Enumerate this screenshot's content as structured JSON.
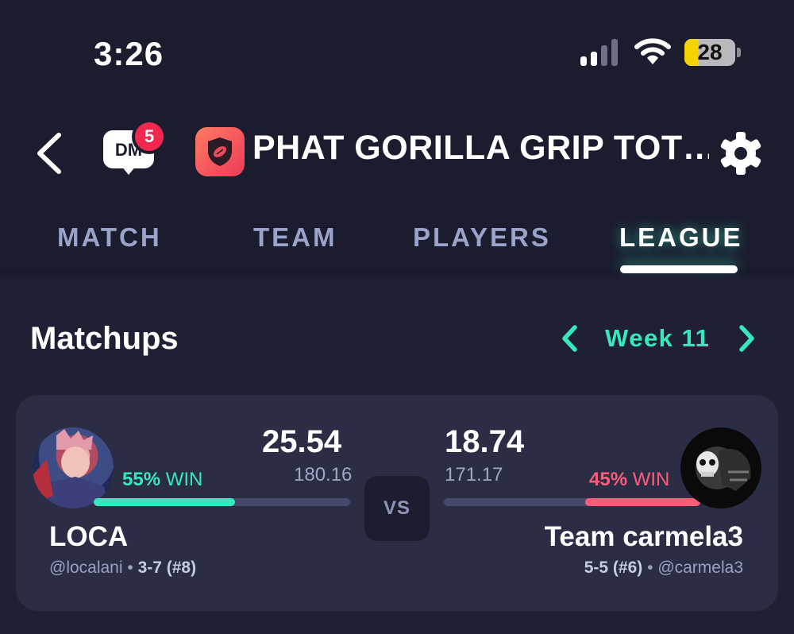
{
  "status_bar": {
    "time": "3:26",
    "battery": "28",
    "battery_level": 0.28
  },
  "nav": {
    "dm_label": "DM",
    "dm_badge": "5",
    "league_name": "PHAT GORILLA GRIP TOT…",
    "icons": [
      "back-chevron-icon",
      "dm-chat-icon",
      "football-shield-icon",
      "gear-icon"
    ]
  },
  "tabs": [
    {
      "label": "MATCH",
      "active": false
    },
    {
      "label": "TEAM",
      "active": false
    },
    {
      "label": "PLAYERS",
      "active": false
    },
    {
      "label": "LEAGUE",
      "active": true
    }
  ],
  "matchups": {
    "title": "Matchups",
    "week_label": "Week 11"
  },
  "matchup": {
    "vs_label": "VS",
    "win_label": "WIN",
    "left": {
      "score": "25.54",
      "projected": "180.16",
      "win_pct": "55%",
      "win_fraction": 0.55,
      "team_name": "LOCA",
      "handle": "@localani",
      "record": "3-7 (#8)"
    },
    "right": {
      "score": "18.74",
      "projected": "171.17",
      "win_pct": "45%",
      "win_fraction": 0.45,
      "team_name": "Team carmela3",
      "handle": "@carmela3",
      "record": "5-5 (#6)"
    }
  },
  "colors": {
    "accent": "#37e8be",
    "lose": "#ff5c7a",
    "badge": "#f0284f",
    "background": "#1b1c2e",
    "card": "#2b2d45"
  }
}
